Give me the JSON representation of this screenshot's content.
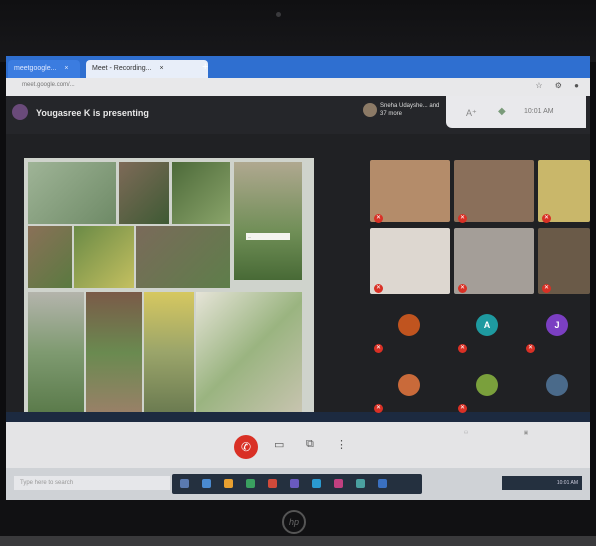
{
  "browser": {
    "tabs": [
      {
        "label": "meetgoogle..."
      },
      {
        "label": "Meet - Recording..."
      }
    ],
    "close_glyph": "×",
    "new_tab_glyph": "+",
    "url": "meet.google.com/..."
  },
  "meet": {
    "presenting_text": "Yougasree K is presenting",
    "pinned_name": "Sneha Udayshe... and 37 more",
    "meeting_time": "10:01 AM",
    "slide_caption": "...",
    "participants_video": [
      {
        "name": "",
        "color": "#b48c6a"
      },
      {
        "name": "",
        "color": "#8a6f5a"
      },
      {
        "name": "",
        "color": "#c9b76a"
      },
      {
        "name": "",
        "color": "#ddd7d0"
      },
      {
        "name": "",
        "color": "#a49e98"
      },
      {
        "name": "",
        "color": "#6a5a48"
      }
    ],
    "participants_avatar": [
      {
        "name": "",
        "letter": "",
        "color": "#c0541f"
      },
      {
        "name": "",
        "letter": "A",
        "color": "#1e9aa0"
      },
      {
        "name": "",
        "letter": "J",
        "color": "#7b3fc2"
      },
      {
        "name": "",
        "letter": "",
        "color": "#c96a3a"
      },
      {
        "name": "",
        "letter": "",
        "color": "#7aa03c"
      },
      {
        "name": "",
        "letter": "",
        "color": "#4a6a8a"
      }
    ],
    "end_call_icon": "phone-hangup-icon"
  },
  "windows": {
    "search_placeholder": "Type here to search",
    "tray_time": "10:01 AM"
  },
  "laptop": {
    "brand_logo": "hp"
  }
}
